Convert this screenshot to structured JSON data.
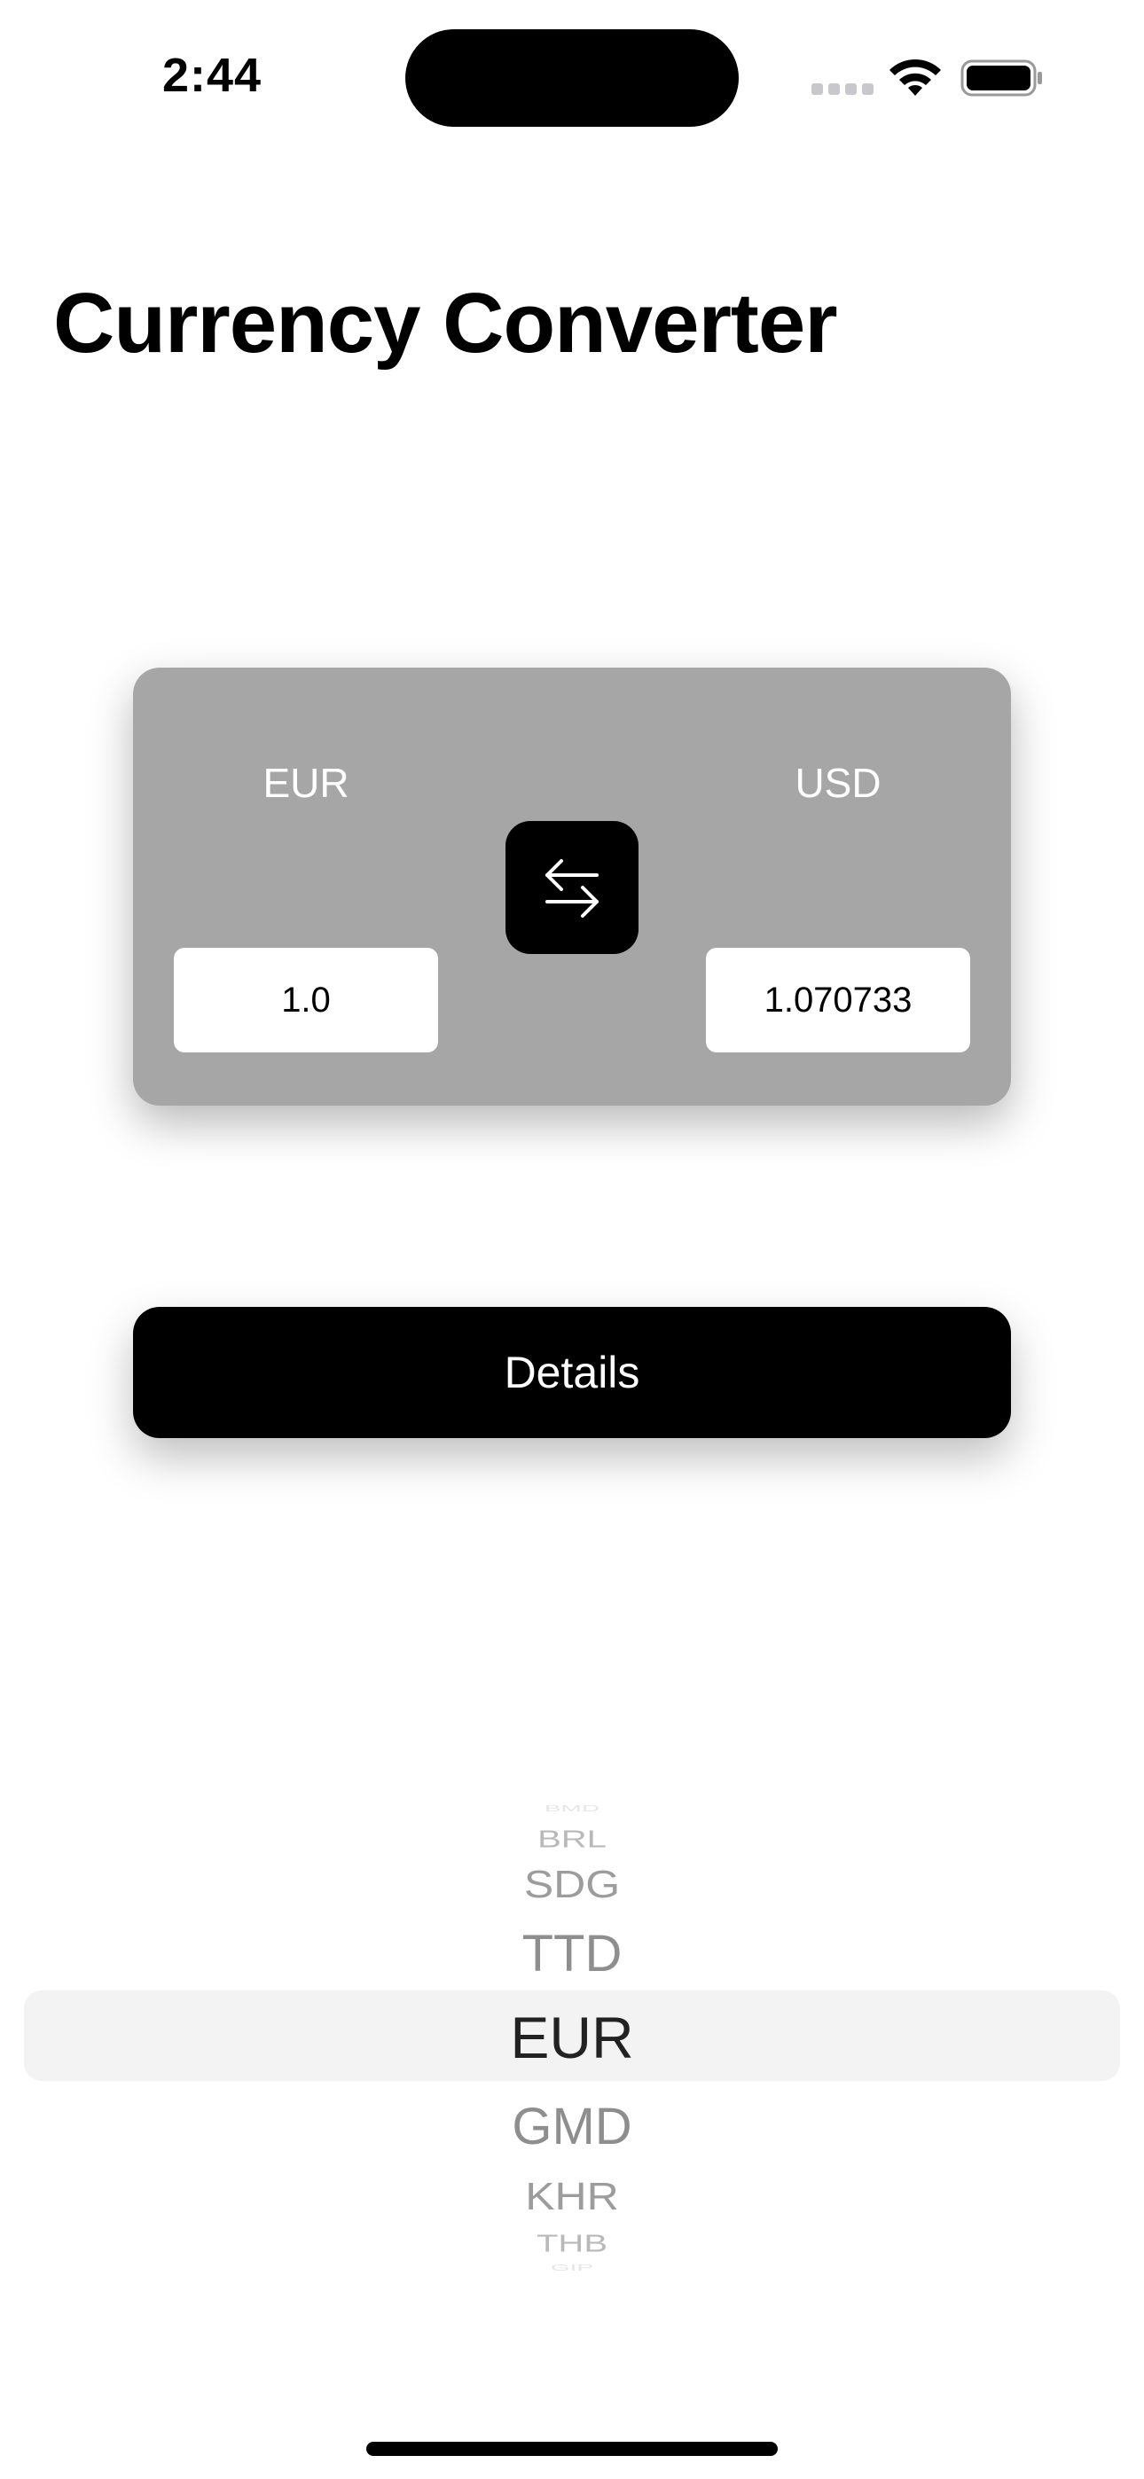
{
  "status_bar": {
    "time": "2:44",
    "icons": [
      "cellular-signal-icon",
      "wifi-icon",
      "battery-icon"
    ]
  },
  "title": "Currency Converter",
  "converter": {
    "from_currency": "EUR",
    "to_currency": "USD",
    "from_amount": "1.0",
    "to_amount": "1.070733",
    "swap_icon": "arrows-left-right-icon"
  },
  "details_button": {
    "label": "Details"
  },
  "picker": {
    "selected": "EUR",
    "items": [
      "BMD",
      "BRL",
      "SDG",
      "TTD",
      "EUR",
      "GMD",
      "KHR",
      "THB",
      "GIP"
    ]
  },
  "colors": {
    "card_background": "#a6a6a6",
    "button_background": "#000000",
    "picker_highlight": "#f3f3f3"
  }
}
